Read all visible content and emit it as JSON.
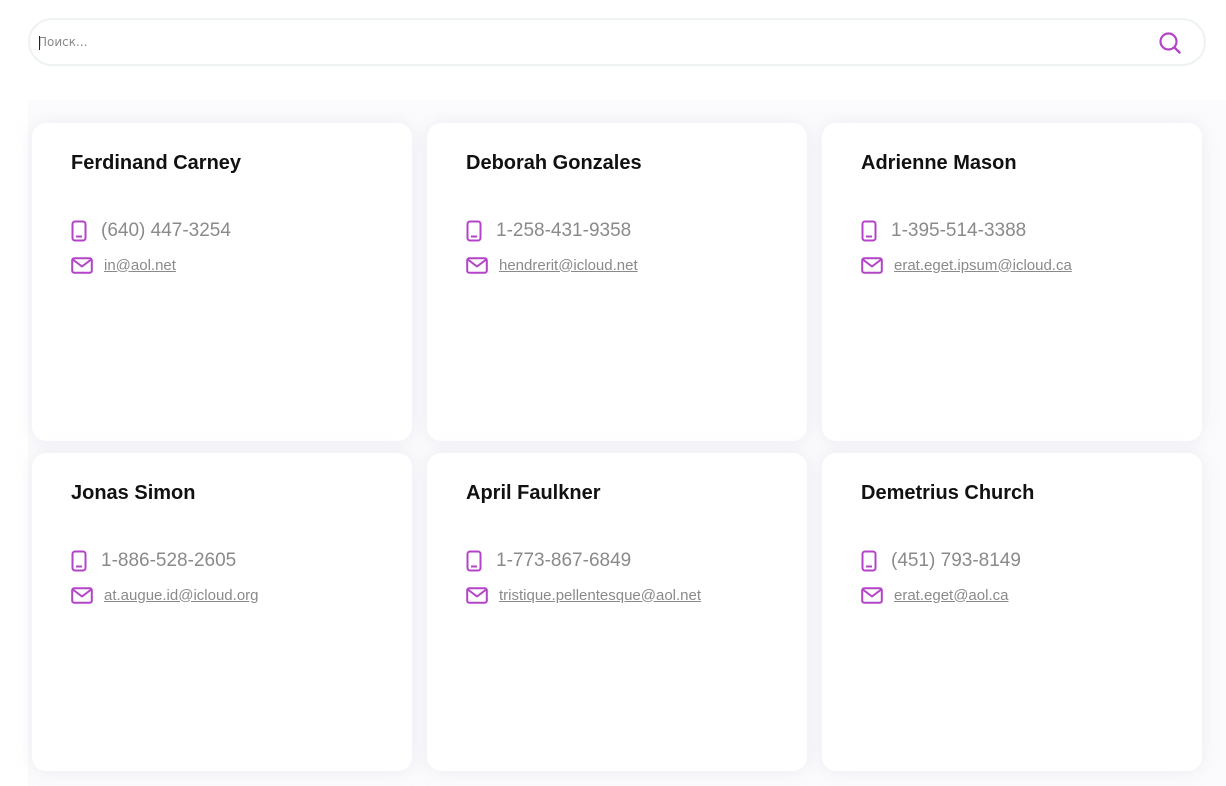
{
  "search": {
    "placeholder": "Поиск...",
    "value": ""
  },
  "colors": {
    "accent": "#b344c8",
    "text_muted": "#8a8a8a",
    "name": "#111111"
  },
  "icons": {
    "search": "search-icon",
    "phone": "phone-icon",
    "email": "mail-icon"
  },
  "contacts": [
    {
      "name": "Ferdinand Carney",
      "phone": "(640) 447-3254",
      "email": "in@aol.net"
    },
    {
      "name": "Deborah Gonzales",
      "phone": "1-258-431-9358",
      "email": "hendrerit@icloud.net"
    },
    {
      "name": "Adrienne Mason",
      "phone": "1-395-514-3388",
      "email": "erat.eget.ipsum@icloud.ca"
    },
    {
      "name": "Jonas Simon",
      "phone": "1-886-528-2605",
      "email": "at.augue.id@icloud.org"
    },
    {
      "name": "April Faulkner",
      "phone": "1-773-867-6849",
      "email": "tristique.pellentesque@aol.net"
    },
    {
      "name": "Demetrius Church",
      "phone": "(451) 793-8149",
      "email": "erat.eget@aol.ca"
    }
  ]
}
